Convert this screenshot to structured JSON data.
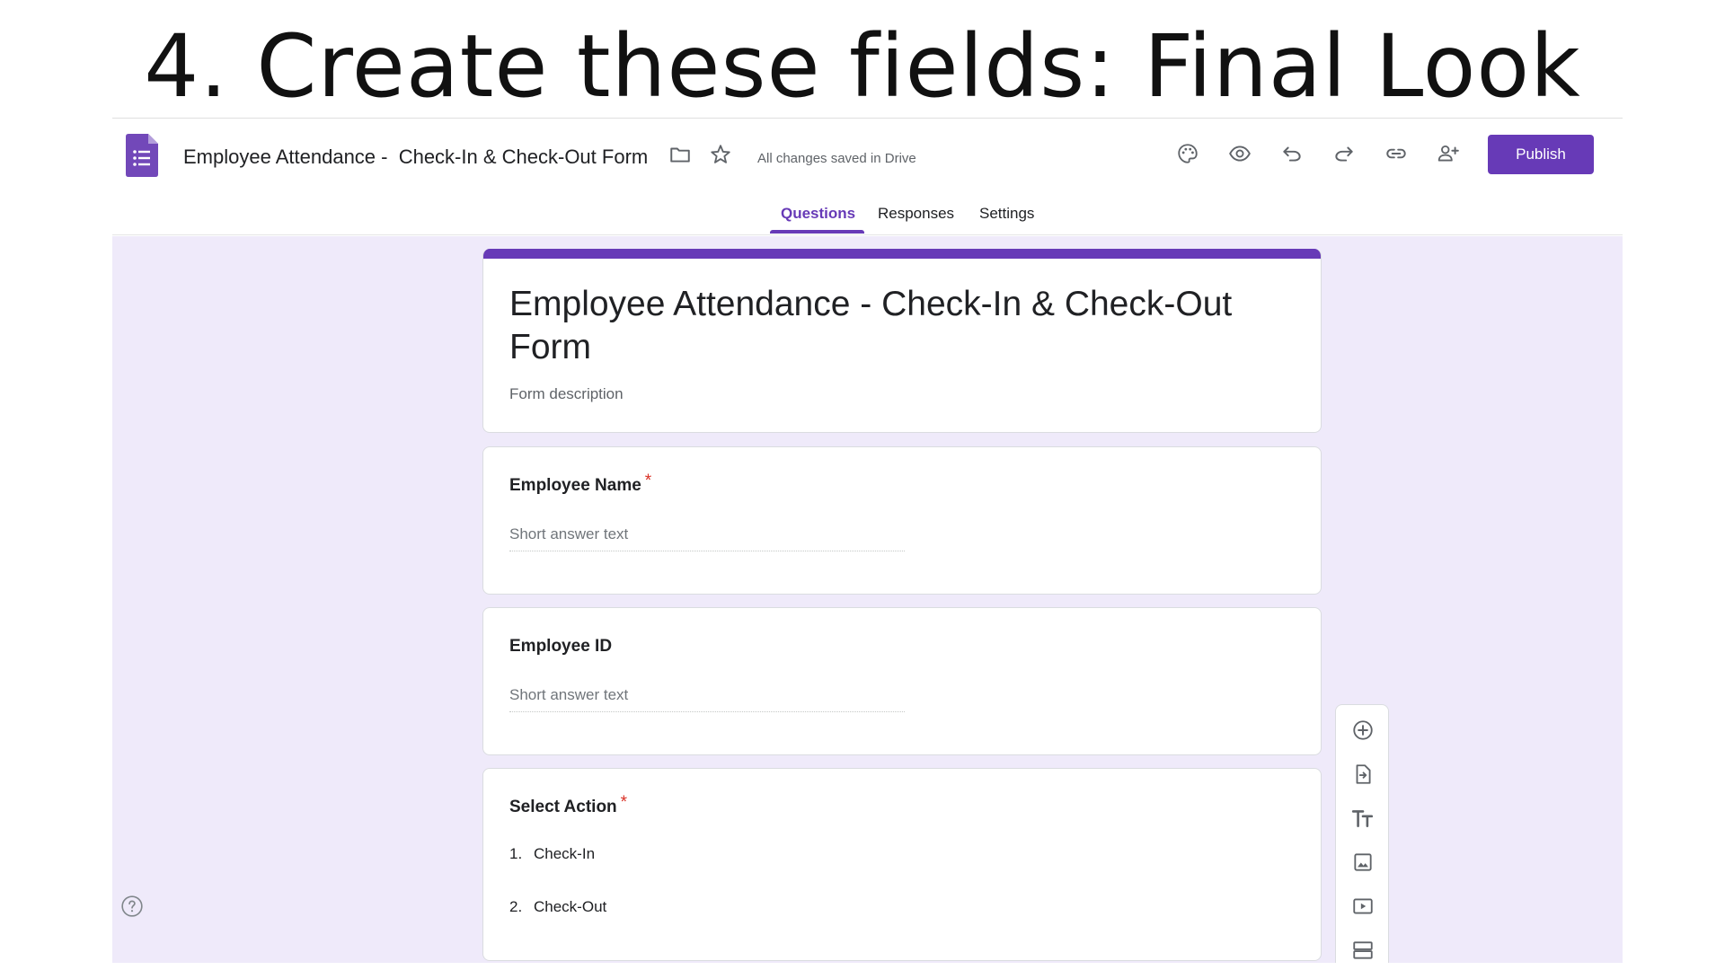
{
  "slide": {
    "heading": "4. Create these fields: Final Look"
  },
  "header": {
    "doc_title": "Employee Attendance -  Check-In & Check-Out Form",
    "saved_status": "All changes saved in Drive",
    "publish_label": "Publish",
    "icons": [
      "forms-logo-icon",
      "folder-icon",
      "star-icon",
      "palette-icon",
      "eye-icon",
      "undo-icon",
      "redo-icon",
      "link-icon",
      "add-person-icon"
    ]
  },
  "tabs": [
    {
      "label": "Questions",
      "active": true
    },
    {
      "label": "Responses",
      "active": false
    },
    {
      "label": "Settings",
      "active": false
    }
  ],
  "form": {
    "title": "Employee Attendance - Check-In & Check-Out Form",
    "description_placeholder": "Form description"
  },
  "questions": [
    {
      "title": "Employee Name",
      "required_mark": "*",
      "placeholder": "Short answer text"
    },
    {
      "title": "Employee ID",
      "placeholder": "Short answer text"
    },
    {
      "title": "Select Action",
      "required_mark": "*",
      "options": [
        {
          "num": "1.",
          "label": "Check-In"
        },
        {
          "num": "2.",
          "label": "Check-Out"
        }
      ]
    }
  ],
  "toolbar_icons": [
    "add-question-icon",
    "import-questions-icon",
    "add-title-icon",
    "add-image-icon",
    "add-video-icon",
    "add-section-icon"
  ],
  "colors": {
    "accent": "#673ab7",
    "canvas_bg": "#efeafa",
    "required": "#d93025"
  }
}
